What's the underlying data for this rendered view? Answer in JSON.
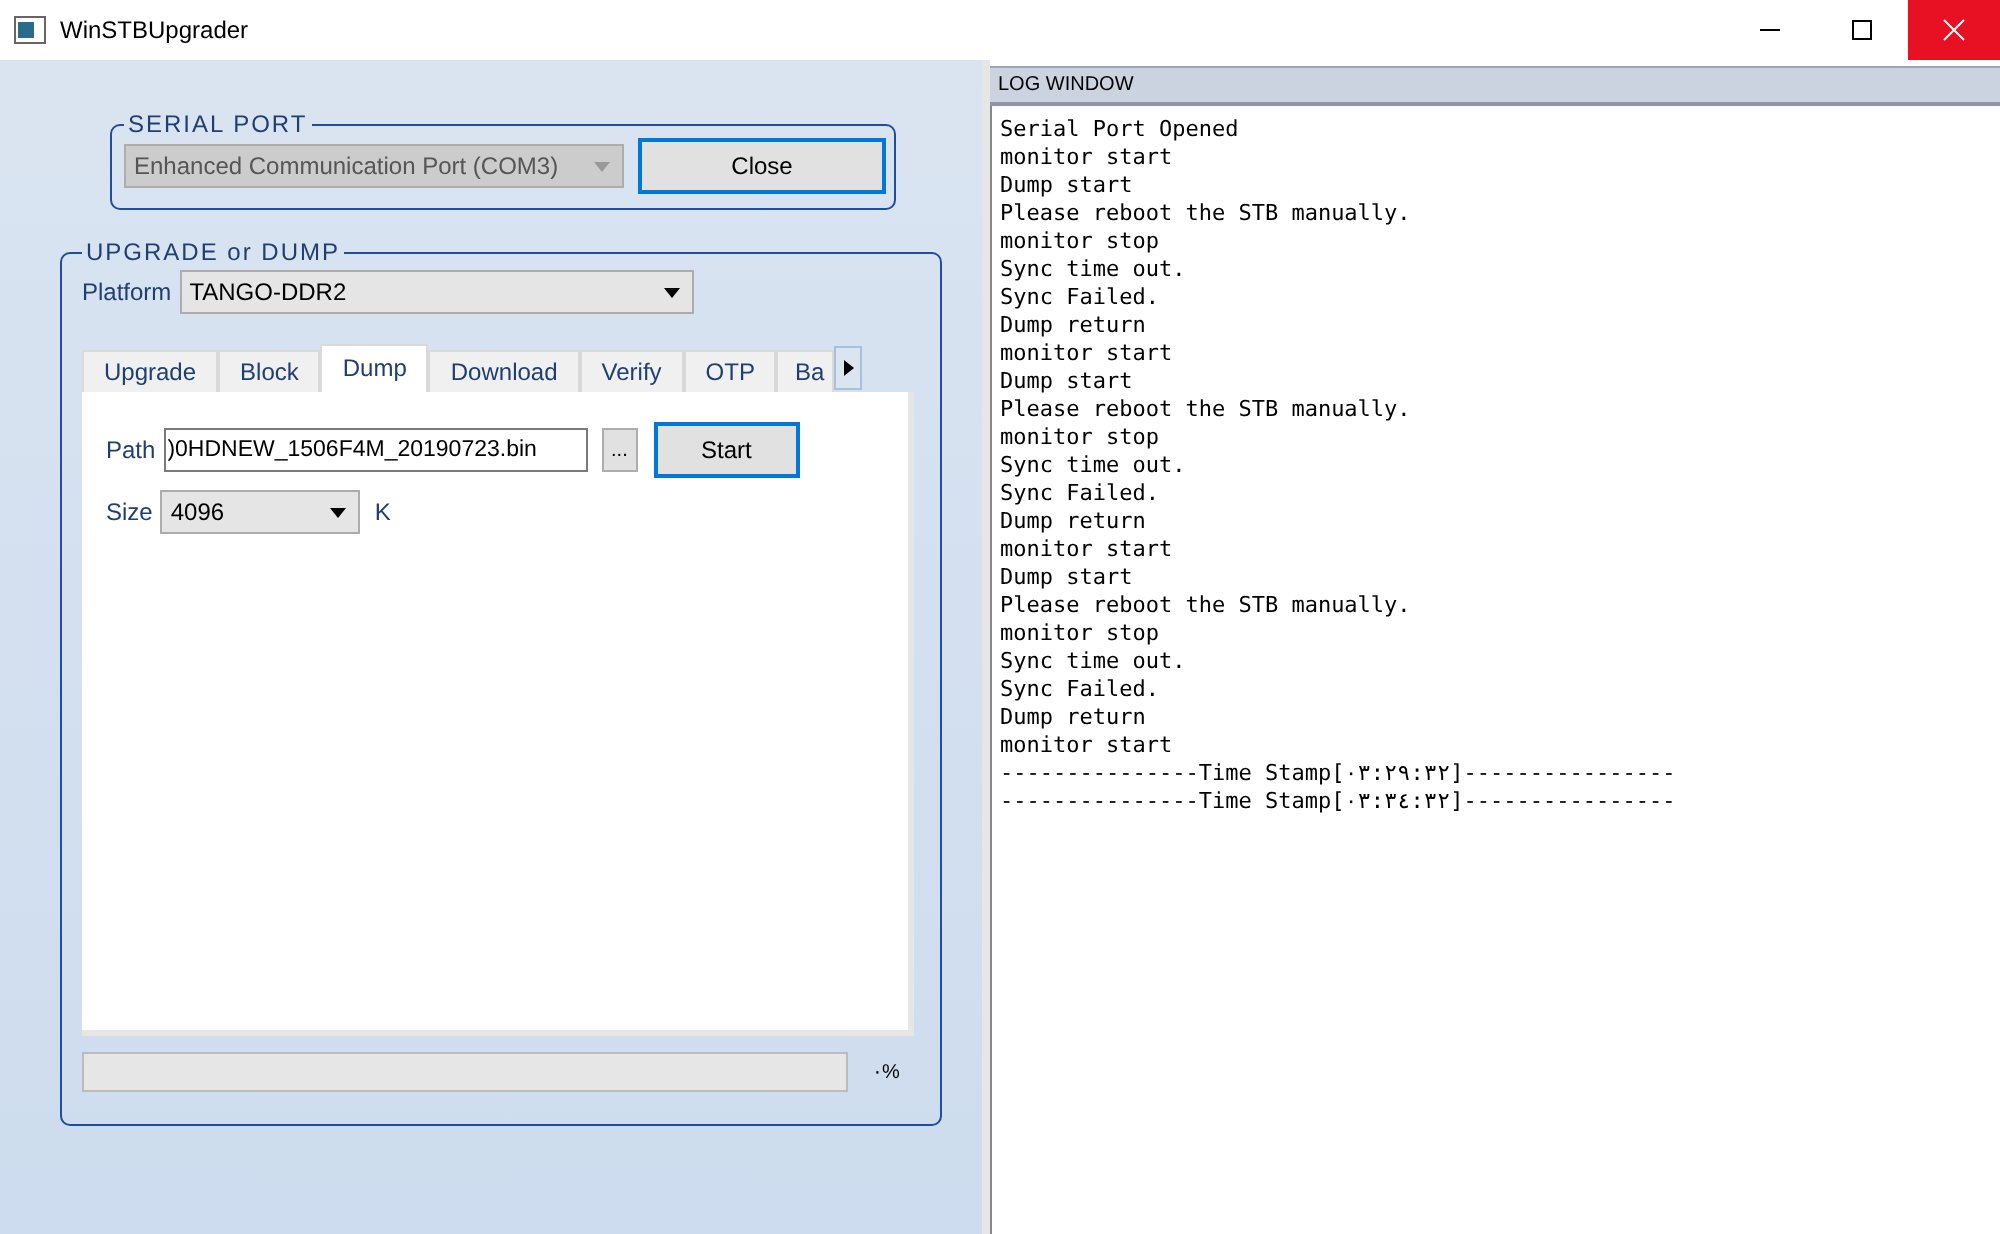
{
  "window": {
    "title": "WinSTBUpgrader"
  },
  "serial_port": {
    "legend": "SERIAL PORT",
    "port": "Enhanced Communication Port (COM3)",
    "port_disabled": true,
    "button": "Close"
  },
  "upgrade": {
    "legend": "UPGRADE or DUMP",
    "platform_label": "Platform",
    "platform": "TANGO-DDR2",
    "tabs": [
      {
        "label": "Upgrade",
        "selected": false
      },
      {
        "label": "Block",
        "selected": false
      },
      {
        "label": "Dump",
        "selected": true
      },
      {
        "label": "Download",
        "selected": false
      },
      {
        "label": "Verify",
        "selected": false
      },
      {
        "label": "OTP",
        "selected": false
      },
      {
        "label": "Ba",
        "selected": false
      }
    ],
    "path_label": "Path",
    "path": ")0HDNEW_1506F4M_20190723.bin",
    "browse": "...",
    "start": "Start",
    "size_label": "Size",
    "size": "4096",
    "size_unit": "K",
    "progress": {
      "level": 0,
      "reading": "٠%"
    }
  },
  "log": {
    "title": "LOG WINDOW",
    "lines": [
      "Serial Port Opened",
      "monitor start",
      "Dump start",
      "Please reboot the STB manually.",
      "monitor stop",
      "Sync time out.",
      "Sync Failed.",
      "Dump return",
      "monitor start",
      "Dump start",
      "Please reboot the STB manually.",
      "monitor stop",
      "Sync time out.",
      "Sync Failed.",
      "Dump return",
      "monitor start",
      "Dump start",
      "Please reboot the STB manually.",
      "monitor stop",
      "Sync time out.",
      "Sync Failed.",
      "Dump return",
      "monitor start",
      "---------------Time Stamp[٠٣:٢٩:٣٢]----------------",
      "---------------Time Stamp[٠٣:٣٤:٣٢]----------------"
    ]
  }
}
